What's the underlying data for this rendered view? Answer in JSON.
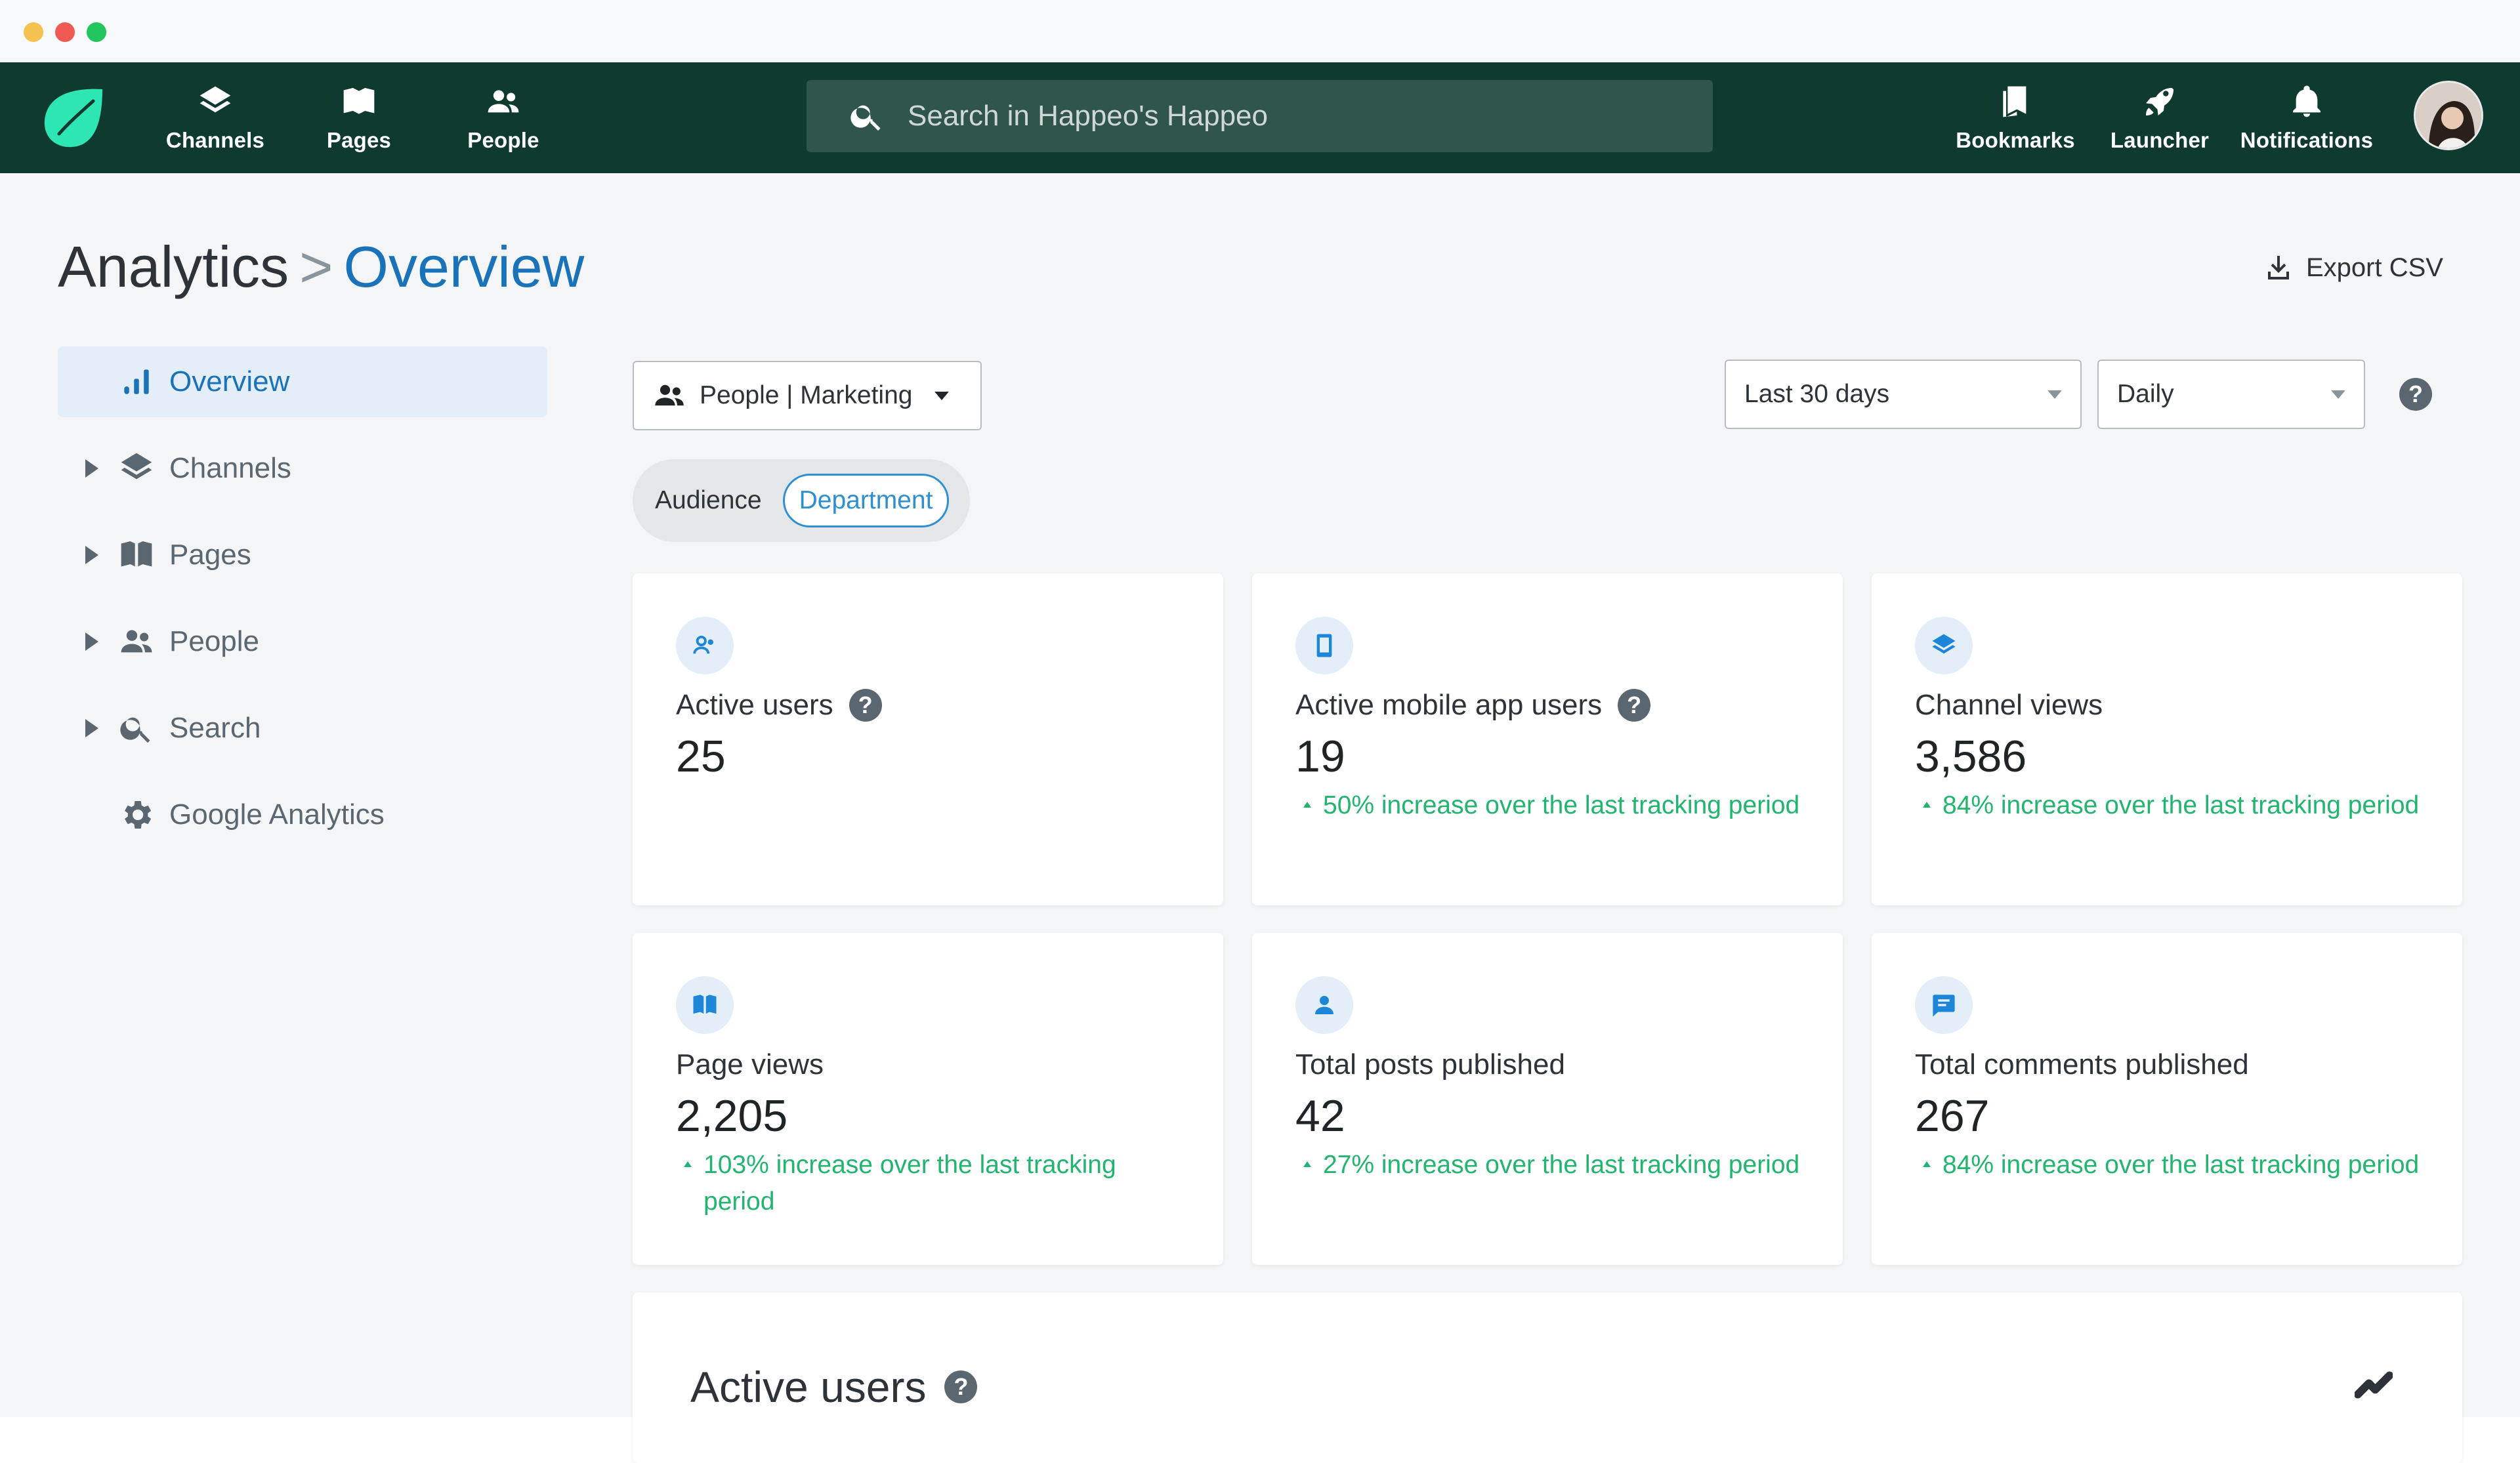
{
  "nav": {
    "items": [
      {
        "label": "Channels",
        "icon": "layers-icon"
      },
      {
        "label": "Pages",
        "icon": "book-icon"
      },
      {
        "label": "People",
        "icon": "people-icon"
      }
    ],
    "search_placeholder": "Search in Happeo's Happeo",
    "right_items": [
      {
        "label": "Bookmarks",
        "icon": "bookmark-icon"
      },
      {
        "label": "Launcher",
        "icon": "rocket-icon"
      },
      {
        "label": "Notifications",
        "icon": "bell-icon"
      }
    ]
  },
  "breadcrumb": {
    "root": "Analytics",
    "separator": ">",
    "current": "Overview"
  },
  "export_label": "Export CSV",
  "sidebar": {
    "items": [
      {
        "label": "Overview",
        "icon": "bar-chart-icon",
        "active": true
      },
      {
        "label": "Channels",
        "icon": "layers-icon"
      },
      {
        "label": "Pages",
        "icon": "book-icon"
      },
      {
        "label": "People",
        "icon": "people-icon"
      },
      {
        "label": "Search",
        "icon": "search-icon"
      },
      {
        "label": "Google Analytics",
        "icon": "gear-icon"
      }
    ]
  },
  "filters": {
    "scope": "People | Marketing",
    "range": "Last 30 days",
    "interval": "Daily",
    "help": "?",
    "segment": {
      "label": "Audience",
      "selected": "Department"
    }
  },
  "cards": [
    {
      "title": "Active users",
      "value": "25",
      "delta": "",
      "help": true,
      "icon": "users-icon"
    },
    {
      "title": "Active mobile app users",
      "value": "19",
      "delta": "50% increase over the last tracking period",
      "help": true,
      "icon": "mobile-icon"
    },
    {
      "title": "Channel views",
      "value": "3,586",
      "delta": "84% increase over the last tracking period",
      "help": false,
      "icon": "layers-icon"
    },
    {
      "title": "Page views",
      "value": "2,205",
      "delta": "103% increase over the last tracking period",
      "help": false,
      "icon": "book-icon"
    },
    {
      "title": "Total posts published",
      "value": "42",
      "delta": "27% increase over the last tracking period",
      "help": false,
      "icon": "person-icon"
    },
    {
      "title": "Total comments published",
      "value": "267",
      "delta": "84% increase over the last tracking period",
      "help": false,
      "icon": "comment-icon"
    }
  ],
  "active_users_section": {
    "title": "Active users",
    "help": "?"
  },
  "colors": {
    "topbar": "#0f3a2f",
    "accent": "#1a73b8",
    "positive": "#22b56f",
    "logo": "#2ee6b3"
  }
}
